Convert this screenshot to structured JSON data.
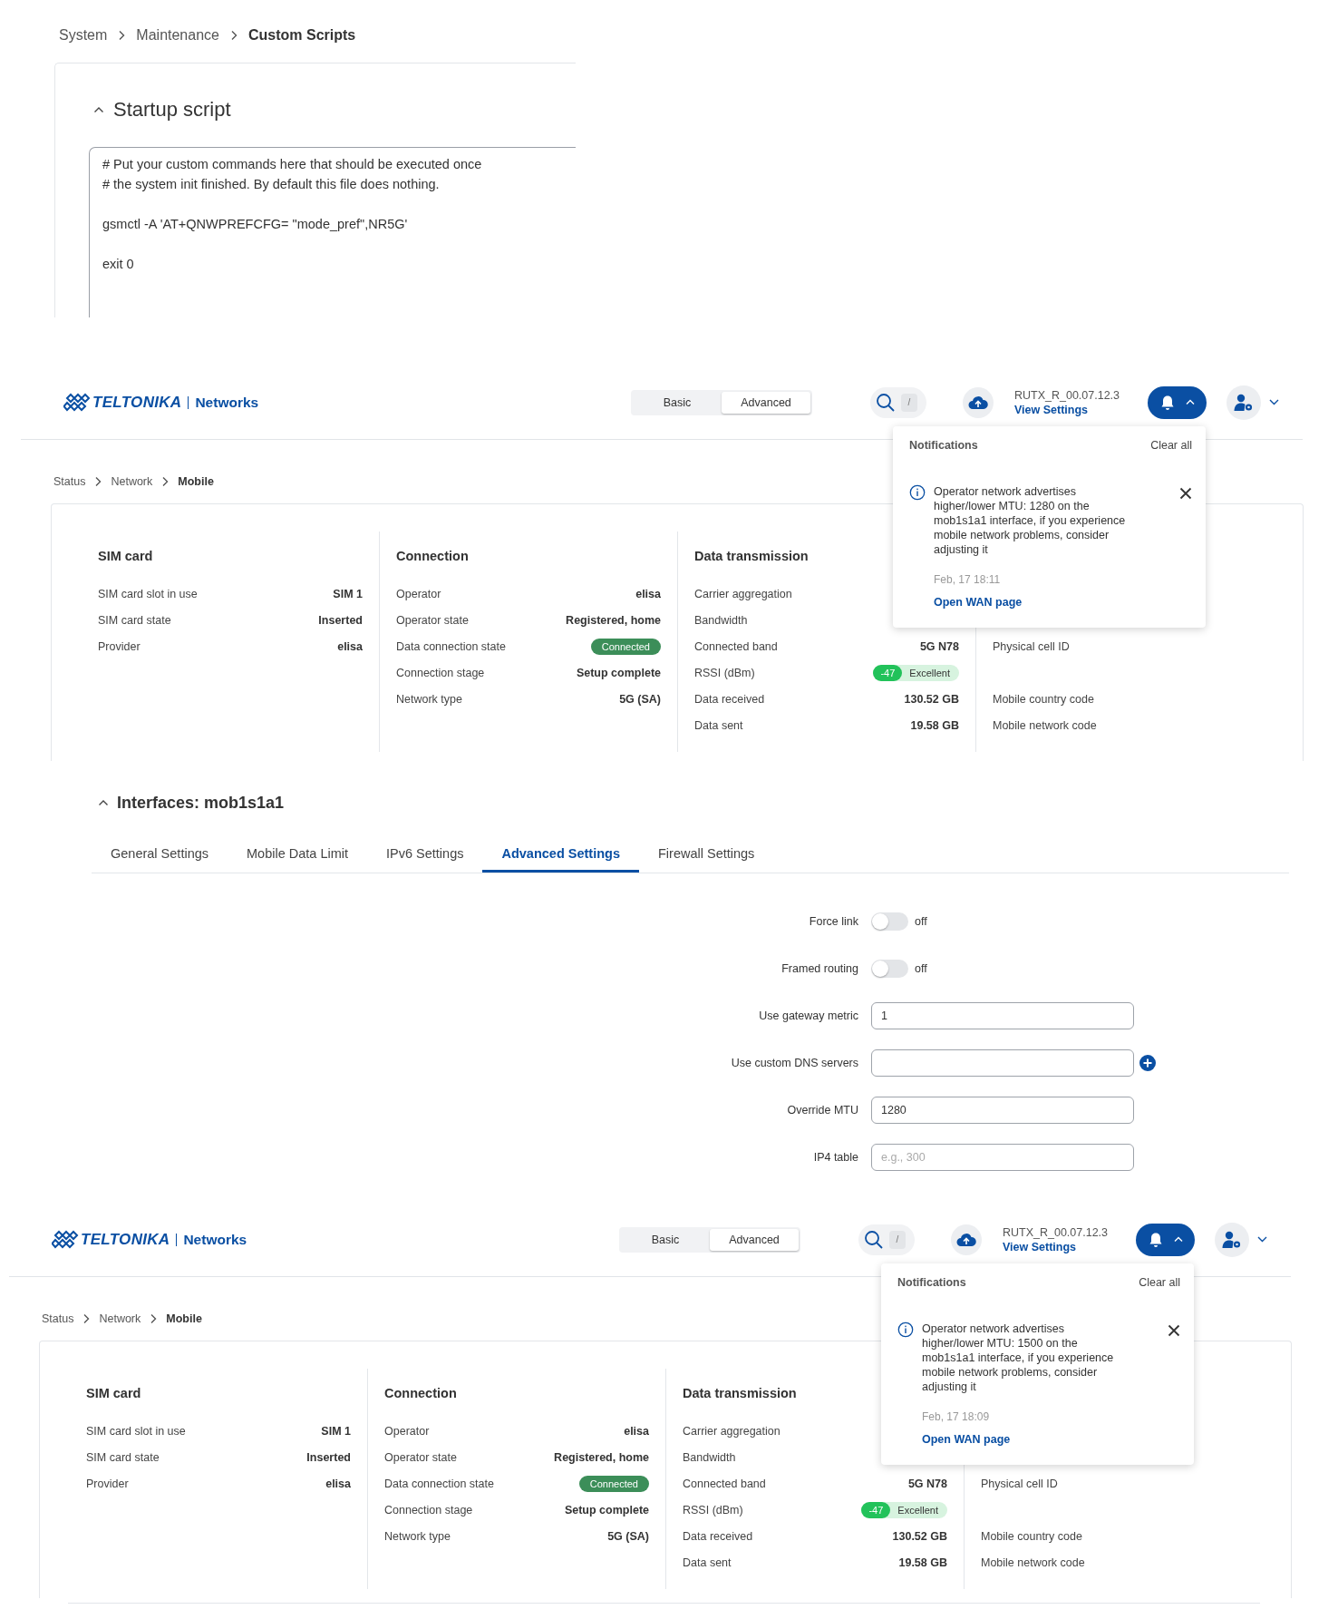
{
  "script_page": {
    "breadcrumb": [
      {
        "label": "System",
        "current": false
      },
      {
        "label": "Maintenance",
        "current": false
      },
      {
        "label": "Custom Scripts",
        "current": true
      }
    ],
    "section": {
      "title": "Startup script",
      "expanded": true
    },
    "script": "# Put your custom commands here that should be executed once\n# the system init finished. By default this file does nothing.\n\ngsmctl -A 'AT+QNWPREFCFG= \"mode_pref\",NR5G'\n\nexit 0"
  },
  "mobile_pages": [
    {
      "header": {
        "brand": "TELTONIKA",
        "brand_sub": "Networks",
        "modes": [
          {
            "label": "Basic",
            "selected": false
          },
          {
            "label": "Advanced",
            "selected": true
          }
        ],
        "search_key": "/",
        "firmware": "RUTX_R_00.07.12.3",
        "settings_link": "View Settings",
        "notifications_expanded": true
      },
      "notifications": {
        "title": "Notifications",
        "clear": "Clear all",
        "message": "Operator network advertises higher/lower MTU: 1280 on the mob1s1a1 interface, if you experience mobile network problems, consider adjusting it",
        "time": "Feb, 17 18:11",
        "link": "Open WAN page"
      },
      "breadcrumb": [
        {
          "label": "Status",
          "current": false
        },
        {
          "label": "Network",
          "current": false
        },
        {
          "label": "Mobile",
          "current": true
        }
      ],
      "columns": [
        {
          "title": "SIM card",
          "rows": [
            {
              "label": "SIM card slot in use",
              "kind": "text",
              "value": "SIM 1"
            },
            {
              "label": "SIM card state",
              "kind": "text",
              "value": "Inserted"
            },
            {
              "label": "Provider",
              "kind": "text",
              "value": "elisa"
            }
          ]
        },
        {
          "title": "Connection",
          "rows": [
            {
              "label": "Operator",
              "kind": "text",
              "value": "elisa"
            },
            {
              "label": "Operator state",
              "kind": "text",
              "value": "Registered, home"
            },
            {
              "label": "Data connection state",
              "kind": "status",
              "value": "Connected"
            },
            {
              "label": "Connection stage",
              "kind": "text",
              "value": "Setup complete"
            },
            {
              "label": "Network type",
              "kind": "text",
              "value": "5G (SA)"
            }
          ]
        },
        {
          "title": "Data transmission",
          "rows": [
            {
              "label": "Carrier aggregation",
              "kind": "text"
            },
            {
              "label": "Bandwidth",
              "kind": "text"
            },
            {
              "label": "Connected band",
              "kind": "text",
              "value": "5G N78"
            },
            {
              "label": "RSSI (dBm)",
              "kind": "signal",
              "value": "-47",
              "quality": "Excellent"
            },
            {
              "label": "Data received",
              "kind": "text",
              "value": "130.52 GB"
            },
            {
              "label": "Data sent",
              "kind": "text",
              "value": "19.58 GB"
            }
          ]
        }
      ],
      "extra_column": [
        {
          "label": "Physical cell ID"
        },
        {
          "label": "Mobile country code"
        },
        {
          "label": "Mobile network code"
        }
      ],
      "interfaces": {
        "title": "Interfaces: mob1s1a1",
        "expanded": true,
        "tabs": [
          {
            "label": "General Settings",
            "selected": false
          },
          {
            "label": "Mobile Data Limit",
            "selected": false
          },
          {
            "label": "IPv6 Settings",
            "selected": false
          },
          {
            "label": "Advanced Settings",
            "selected": true
          },
          {
            "label": "Firewall Settings",
            "selected": false
          }
        ],
        "fields": [
          {
            "label": "Force link",
            "kind": "toggle",
            "on": false,
            "state_text": "off"
          },
          {
            "label": "Framed routing",
            "kind": "toggle",
            "on": false,
            "state_text": "off"
          },
          {
            "label": "Use gateway metric",
            "kind": "input",
            "value": "1"
          },
          {
            "label": "Use custom DNS servers",
            "kind": "input",
            "add_button": true
          },
          {
            "label": "Override MTU",
            "kind": "input",
            "value": "1280"
          },
          {
            "label": "IP4 table",
            "kind": "input",
            "placeholder": "e.g., 300"
          }
        ]
      }
    },
    {
      "header": {
        "brand": "TELTONIKA",
        "brand_sub": "Networks",
        "modes": [
          {
            "label": "Basic",
            "selected": false
          },
          {
            "label": "Advanced",
            "selected": true
          }
        ],
        "search_key": "/",
        "firmware": "RUTX_R_00.07.12.3",
        "settings_link": "View Settings",
        "notifications_expanded": true
      },
      "notifications": {
        "title": "Notifications",
        "clear": "Clear all",
        "message": "Operator network advertises higher/lower MTU: 1500 on the mob1s1a1 interface, if you experience mobile network problems, consider adjusting it",
        "time": "Feb, 17 18:09",
        "link": "Open WAN page"
      },
      "breadcrumb": [
        {
          "label": "Status",
          "current": false
        },
        {
          "label": "Network",
          "current": false
        },
        {
          "label": "Mobile",
          "current": true
        }
      ],
      "columns": [
        {
          "title": "SIM card",
          "rows": [
            {
              "label": "SIM card slot in use",
              "kind": "text",
              "value": "SIM 1"
            },
            {
              "label": "SIM card state",
              "kind": "text",
              "value": "Inserted"
            },
            {
              "label": "Provider",
              "kind": "text",
              "value": "elisa"
            }
          ]
        },
        {
          "title": "Connection",
          "rows": [
            {
              "label": "Operator",
              "kind": "text",
              "value": "elisa"
            },
            {
              "label": "Operator state",
              "kind": "text",
              "value": "Registered, home"
            },
            {
              "label": "Data connection state",
              "kind": "status",
              "value": "Connected"
            },
            {
              "label": "Connection stage",
              "kind": "text",
              "value": "Setup complete"
            },
            {
              "label": "Network type",
              "kind": "text",
              "value": "5G (SA)"
            }
          ]
        },
        {
          "title": "Data transmission",
          "rows": [
            {
              "label": "Carrier aggregation",
              "kind": "text"
            },
            {
              "label": "Bandwidth",
              "kind": "text"
            },
            {
              "label": "Connected band",
              "kind": "text",
              "value": "5G N78"
            },
            {
              "label": "RSSI (dBm)",
              "kind": "signal",
              "value": "-47",
              "quality": "Excellent"
            },
            {
              "label": "Data received",
              "kind": "text",
              "value": "130.52 GB"
            },
            {
              "label": "Data sent",
              "kind": "text",
              "value": "19.58 GB"
            }
          ]
        }
      ],
      "extra_column": [
        {
          "label": "Physical cell ID"
        },
        {
          "label": "Mobile country code"
        },
        {
          "label": "Mobile network code"
        }
      ]
    }
  ]
}
